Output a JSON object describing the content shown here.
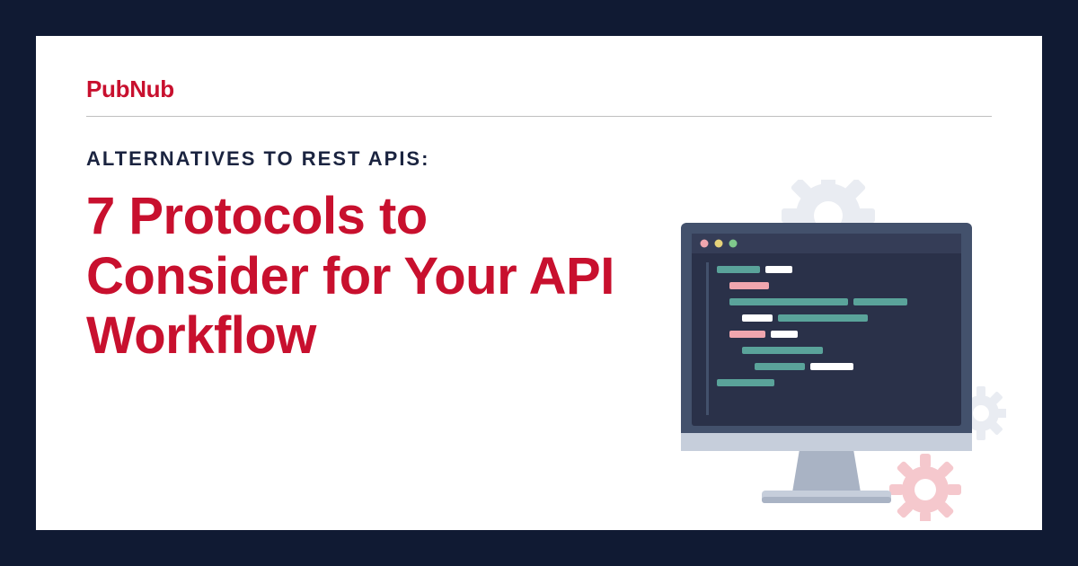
{
  "brand": "PubNub",
  "kicker": "ALTERNATIVES TO REST APIS:",
  "headline": "7 Protocols to Consider for Your API Workflow",
  "colors": {
    "background_frame": "#101a33",
    "card_bg": "#ffffff",
    "accent_red": "#c8102e",
    "kicker_color": "#1b2440",
    "divider": "#bfbfbf",
    "monitor_bezel": "#43516c",
    "monitor_screen": "#2a3149",
    "monitor_stand": "#a9b3c4",
    "gear_light": "#e9ecf2",
    "gear_pink": "#f5c8cd",
    "code_teal": "#5aa39a",
    "code_white": "#ffffff",
    "code_pink": "#f0a6ae"
  },
  "illustration": {
    "name": "computer-monitor-with-code-and-gears",
    "window_dots": [
      "#f0a6ae",
      "#e6d37a",
      "#7fc98c"
    ]
  }
}
